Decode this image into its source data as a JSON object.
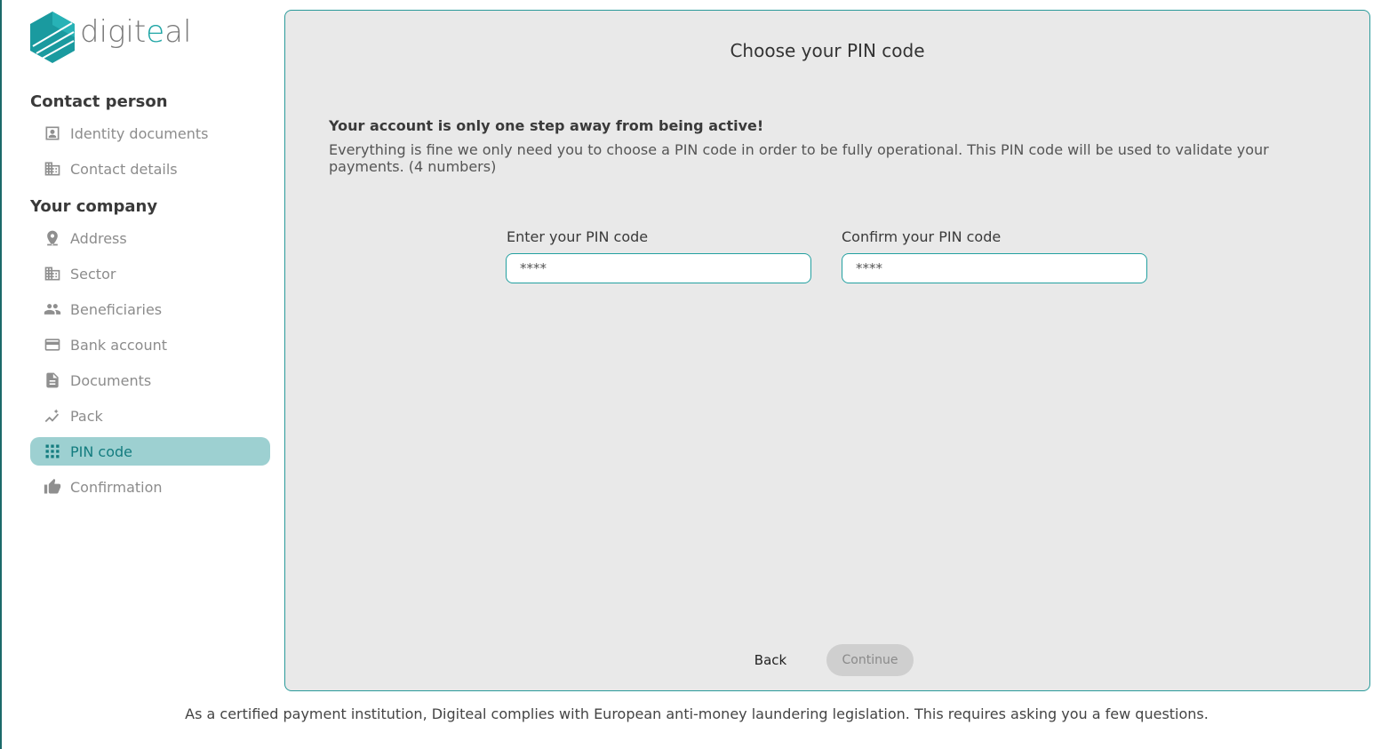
{
  "brand": {
    "logo_text_left": "digit",
    "logo_text_accent": "e",
    "logo_text_right": "al",
    "accent_color": "#1fa5a5"
  },
  "sidebar": {
    "sections": [
      {
        "title": "Contact person"
      },
      {
        "title": "Your company"
      }
    ],
    "items": [
      {
        "label": "Identity documents",
        "icon": "id-card-icon"
      },
      {
        "label": "Contact details",
        "icon": "building-icon"
      },
      {
        "label": "Address",
        "icon": "location-pin-icon"
      },
      {
        "label": "Sector",
        "icon": "building-icon"
      },
      {
        "label": "Beneficiaries",
        "icon": "people-icon"
      },
      {
        "label": "Bank account",
        "icon": "credit-card-icon"
      },
      {
        "label": "Documents",
        "icon": "document-icon"
      },
      {
        "label": "Pack",
        "icon": "chart-line-icon"
      },
      {
        "label": "PIN code",
        "icon": "keypad-icon",
        "active": true
      },
      {
        "label": "Confirmation",
        "icon": "thumb-up-icon"
      }
    ]
  },
  "main": {
    "title": "Choose your PIN code",
    "intro_strong": "Your account is only one step away from being active!",
    "intro_text": "Everything is fine we only need you to choose a PIN code in order to be fully operational. This PIN code will be used to validate your payments. (4 numbers)",
    "pin": {
      "label": "Enter your PIN code",
      "placeholder": "****",
      "value": ""
    },
    "confirm_pin": {
      "label": "Confirm your PIN code",
      "placeholder": "****",
      "value": ""
    },
    "back_label": "Back",
    "continue_label": "Continue"
  },
  "footer": {
    "note": "As a certified payment institution, Digiteal complies with European anti-money laundering legislation. This requires asking you a few questions."
  }
}
